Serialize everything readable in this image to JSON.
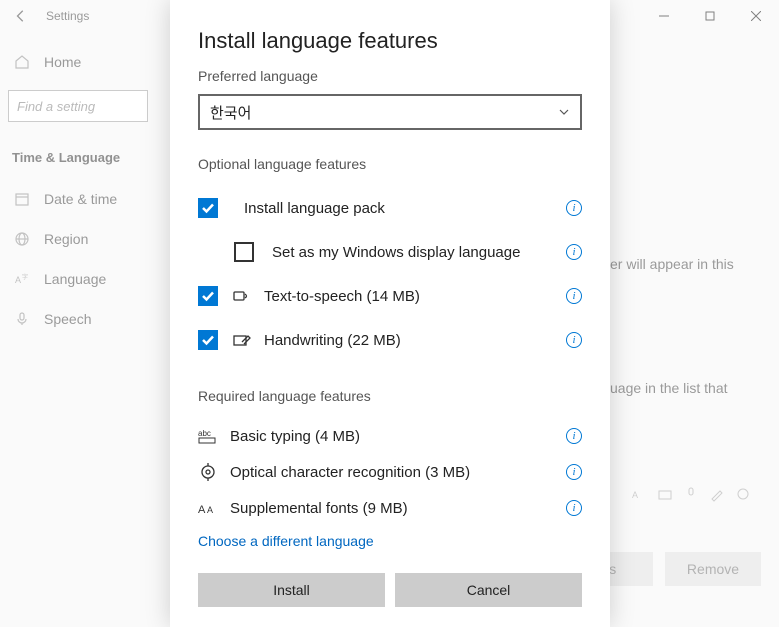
{
  "window": {
    "title": "Settings"
  },
  "sidebar": {
    "home": "Home",
    "search_placeholder": "Find a setting",
    "section": "Time & Language",
    "items": [
      {
        "label": "Date & time"
      },
      {
        "label": "Region"
      },
      {
        "label": "Language"
      },
      {
        "label": "Speech"
      }
    ]
  },
  "background": {
    "hint1": "er will appear in this",
    "hint2": "uage in the list that",
    "buttons": {
      "options": "ons",
      "remove": "Remove"
    }
  },
  "dialog": {
    "title": "Install language features",
    "preferred_label": "Preferred language",
    "selected_language": "한국어",
    "optional_header": "Optional language features",
    "optional": [
      {
        "label": "Install language pack",
        "checked": true,
        "indent": false,
        "icon": null
      },
      {
        "label": "Set as my Windows display language",
        "checked": false,
        "indent": true,
        "icon": null
      },
      {
        "label": "Text-to-speech (14 MB)",
        "checked": true,
        "indent": false,
        "icon": "tts"
      },
      {
        "label": "Handwriting (22 MB)",
        "checked": true,
        "indent": false,
        "icon": "handwriting"
      }
    ],
    "required_header": "Required language features",
    "required": [
      {
        "label": "Basic typing (4 MB)",
        "icon": "abc"
      },
      {
        "label": "Optical character recognition (3 MB)",
        "icon": "ocr"
      },
      {
        "label": "Supplemental fonts (9 MB)",
        "icon": "font"
      }
    ],
    "link": "Choose a different language",
    "install": "Install",
    "cancel": "Cancel"
  }
}
